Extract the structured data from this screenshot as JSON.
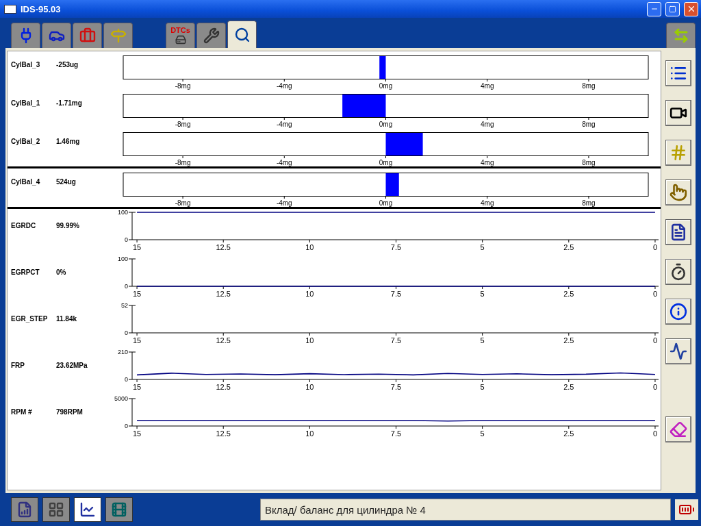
{
  "window": {
    "title": "IDS-95.03"
  },
  "top_tabs": [
    {
      "kind": "connector",
      "selected": false
    },
    {
      "kind": "vehicle",
      "selected": false
    },
    {
      "kind": "toolbox",
      "selected": false
    },
    {
      "kind": "signpost",
      "selected": false
    },
    {
      "kind": "dtc",
      "label": "DTCs",
      "selected": false
    },
    {
      "kind": "wrench",
      "selected": false
    },
    {
      "kind": "inspect",
      "selected": true
    }
  ],
  "bar_groups": [
    {
      "channels": [
        {
          "reading": "-253ug",
          "chart_data": {
            "type": "bar",
            "orientation": "horizontal",
            "categories": [
              "CylBal_3"
            ],
            "values": [
              -0.25
            ],
            "xlim": [
              -10.35,
              10.35
            ],
            "xticks": [
              {
                "value": -8,
                "label": "-8mg"
              },
              {
                "value": -4,
                "label": "-4mg"
              },
              {
                "value": 0,
                "label": "0mg"
              },
              {
                "value": 4,
                "label": "4mg"
              },
              {
                "value": 8,
                "label": "8mg"
              }
            ]
          }
        },
        {
          "reading": "-1.71mg",
          "chart_data": {
            "type": "bar",
            "orientation": "horizontal",
            "categories": [
              "CylBal_1"
            ],
            "values": [
              -1.71
            ],
            "xlim": [
              -10.35,
              10.35
            ],
            "xticks": [
              {
                "value": -8,
                "label": "-8mg"
              },
              {
                "value": -4,
                "label": "-4mg"
              },
              {
                "value": 0,
                "label": "0mg"
              },
              {
                "value": 4,
                "label": "4mg"
              },
              {
                "value": 8,
                "label": "8mg"
              }
            ]
          }
        },
        {
          "reading": "1.46mg",
          "chart_data": {
            "type": "bar",
            "orientation": "horizontal",
            "categories": [
              "CylBal_2"
            ],
            "values": [
              1.46
            ],
            "xlim": [
              -10.35,
              10.35
            ],
            "xticks": [
              {
                "value": -8,
                "label": "-8mg"
              },
              {
                "value": -4,
                "label": "-4mg"
              },
              {
                "value": 0,
                "label": "0mg"
              },
              {
                "value": 4,
                "label": "4mg"
              },
              {
                "value": 8,
                "label": "8mg"
              }
            ]
          }
        }
      ]
    },
    {
      "channels": [
        {
          "reading": "524ug",
          "chart_data": {
            "type": "bar",
            "orientation": "horizontal",
            "categories": [
              "CylBal_4"
            ],
            "values": [
              0.52
            ],
            "xlim": [
              -10.35,
              10.35
            ],
            "xticks": [
              {
                "value": -8,
                "label": "-8mg"
              },
              {
                "value": -4,
                "label": "-4mg"
              },
              {
                "value": 0,
                "label": "0mg"
              },
              {
                "value": 4,
                "label": "4mg"
              },
              {
                "value": 8,
                "label": "8mg"
              }
            ]
          }
        }
      ]
    }
  ],
  "trends": [
    {
      "reading": "99.99%",
      "chart_data": {
        "type": "line",
        "x": [
          15,
          14,
          13,
          12,
          11,
          10,
          9,
          8,
          7,
          6,
          5,
          4,
          3,
          2,
          1,
          0
        ],
        "series": [
          {
            "name": "EGRDC",
            "color": "#000080",
            "values": [
              100,
              100,
              100,
              100,
              100,
              100,
              100,
              100,
              100,
              100,
              100,
              100,
              100,
              100,
              100,
              100
            ]
          }
        ],
        "xlim": [
          15.14,
          -0.1
        ],
        "ylim": [
          0,
          100
        ],
        "xticks": [
          15,
          12.5,
          10,
          7.5,
          5,
          2.5,
          0
        ],
        "yticks": [
          0,
          100
        ]
      }
    },
    {
      "reading": "0%",
      "chart_data": {
        "type": "line",
        "x": [
          15,
          14,
          13,
          12,
          11,
          10,
          9,
          8,
          7,
          6,
          5,
          4,
          3,
          2,
          1,
          0
        ],
        "series": [
          {
            "name": "EGRPCT",
            "color": "#000080",
            "values": [
              0,
              0,
              0,
              0,
              0,
              0,
              0,
              0,
              0,
              0,
              0,
              0,
              0,
              0,
              0,
              0
            ]
          }
        ],
        "xlim": [
          15.14,
          -0.1
        ],
        "ylim": [
          0,
          100
        ],
        "xticks": [
          15,
          12.5,
          10,
          7.5,
          5,
          2.5,
          0
        ],
        "yticks": [
          0,
          100
        ]
      }
    },
    {
      "name": "EGR_STEP",
      "reading": "11.84k",
      "chart_data": {
        "type": "line",
        "xlim": [
          15.14,
          -0.1
        ],
        "ylim": [
          0,
          52
        ],
        "xticks": [
          15,
          12.5,
          10,
          7.5,
          5,
          2.5,
          0
        ],
        "yticks": [
          0,
          52
        ]
      }
    },
    {
      "reading": "23.62MPa",
      "chart_data": {
        "type": "line",
        "x": [
          15,
          14,
          13,
          12,
          11,
          10,
          9,
          8,
          7,
          6,
          5,
          4,
          3,
          2,
          1,
          0
        ],
        "series": [
          {
            "name": "FRP",
            "color": "#000080",
            "values": [
              35,
              48,
              38,
              42,
              36,
              44,
              37,
              41,
              35,
              46,
              38,
              43,
              36,
              40,
              50,
              38
            ]
          }
        ],
        "xlim": [
          15.14,
          -0.1
        ],
        "ylim": [
          0,
          210
        ],
        "xticks": [
          15,
          12.5,
          10,
          7.5,
          5,
          2.5,
          0
        ],
        "yticks": [
          0,
          210
        ]
      }
    },
    {
      "reading": "798RPM",
      "chart_data": {
        "type": "line",
        "x": [
          15,
          14,
          13,
          12,
          11,
          10,
          9,
          8,
          7,
          6,
          5,
          4,
          3,
          2,
          1,
          0
        ],
        "series": [
          {
            "name": "RPM #",
            "color": "#000080",
            "values": [
              1000,
              1000,
              1000,
              1000,
              1000,
              1000,
              1000,
              1000,
              1000,
              900,
              1000,
              1000,
              1000,
              1000,
              1000,
              1000
            ]
          }
        ],
        "xlim": [
          15.14,
          -0.1
        ],
        "ylim": [
          0,
          5000
        ],
        "xticks": [
          15,
          12.5,
          10,
          7.5,
          5,
          2.5,
          0
        ],
        "yticks": [
          0,
          5000
        ]
      }
    }
  ],
  "tools": [
    {
      "kind": "list"
    },
    {
      "kind": "camera"
    },
    {
      "kind": "hash"
    },
    {
      "kind": "pointer"
    },
    {
      "kind": "document"
    },
    {
      "kind": "timer"
    },
    {
      "kind": "info"
    },
    {
      "kind": "scale"
    },
    {
      "kind": "spacer"
    },
    {
      "kind": "eraser"
    }
  ],
  "bottom_tabs": [
    {
      "kind": "report",
      "selected": false
    },
    {
      "kind": "grid",
      "selected": false
    },
    {
      "kind": "datalog",
      "selected": true
    },
    {
      "kind": "playback",
      "selected": false
    }
  ],
  "status_bar": {
    "text": "Вклад/ баланс для цилиндра № 4"
  }
}
